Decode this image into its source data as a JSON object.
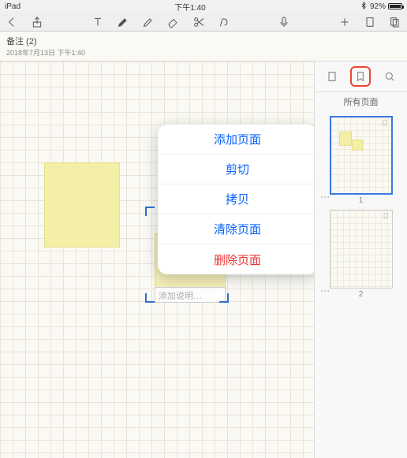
{
  "status": {
    "device": "iPad",
    "time": "下午1:40",
    "battery_pct": "92%"
  },
  "note": {
    "title": "备注 (2)",
    "date": "2018年7月13日 下午1:40"
  },
  "caption_placeholder": "添加说明…",
  "popup": {
    "items": [
      {
        "label": "添加页面",
        "danger": false
      },
      {
        "label": "剪切",
        "danger": false
      },
      {
        "label": "拷贝",
        "danger": false
      },
      {
        "label": "清除页面",
        "danger": false
      },
      {
        "label": "删除页面",
        "danger": true
      }
    ]
  },
  "sidebar": {
    "title": "所有页面",
    "pages": [
      {
        "num": "1",
        "selected": true,
        "stickies": [
          {
            "x": 10,
            "y": 18,
            "w": 16,
            "h": 18
          },
          {
            "x": 26,
            "y": 28,
            "w": 14,
            "h": 14
          }
        ]
      },
      {
        "num": "2",
        "selected": false,
        "stickies": []
      }
    ]
  }
}
